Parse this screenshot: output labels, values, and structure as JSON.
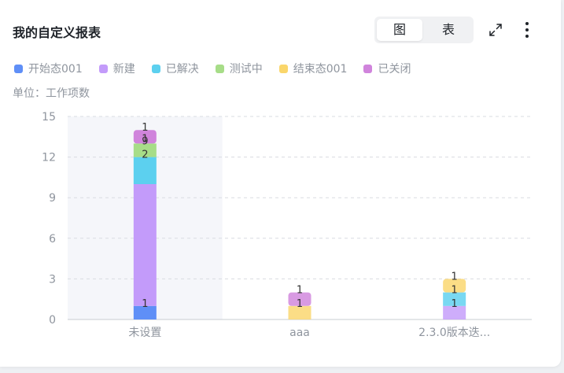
{
  "header": {
    "title": "我的自定义报表",
    "toggle": {
      "chart_label": "图",
      "table_label": "表",
      "active": "chart"
    }
  },
  "legend_colors": {
    "开始态001": "#5f8ff7",
    "新建": "#c39bfa",
    "已解决": "#5cd0ef",
    "测试中": "#a7dd88",
    "结束态001": "#fad66b",
    "已关闭": "#d084dc"
  },
  "chart_data": {
    "type": "bar",
    "stacked": true,
    "unit_label": "单位：工作项数",
    "categories": [
      "未设置",
      "aaa",
      "2.3.0版本迭..."
    ],
    "ylim": [
      0,
      15
    ],
    "yticks": [
      0,
      3,
      6,
      9,
      12,
      15
    ],
    "grid": true,
    "legend_position": "top-left",
    "highlighted_category": "未设置",
    "series": [
      {
        "name": "开始态001",
        "values": [
          1,
          0,
          0
        ]
      },
      {
        "name": "新建",
        "values": [
          9,
          0,
          1
        ]
      },
      {
        "name": "已解决",
        "values": [
          2,
          0,
          1
        ]
      },
      {
        "name": "测试中",
        "values": [
          1,
          0,
          0
        ]
      },
      {
        "name": "结束态001",
        "values": [
          0,
          1,
          1
        ]
      },
      {
        "name": "已关闭",
        "values": [
          1,
          1,
          0
        ]
      }
    ],
    "data_labels": [
      [
        "1",
        "",
        "2",
        "9",
        "1",
        "1"
      ],
      [
        "",
        "",
        "",
        "",
        "1",
        "1"
      ],
      [
        "",
        "1",
        "1",
        "",
        "1",
        ""
      ]
    ]
  }
}
